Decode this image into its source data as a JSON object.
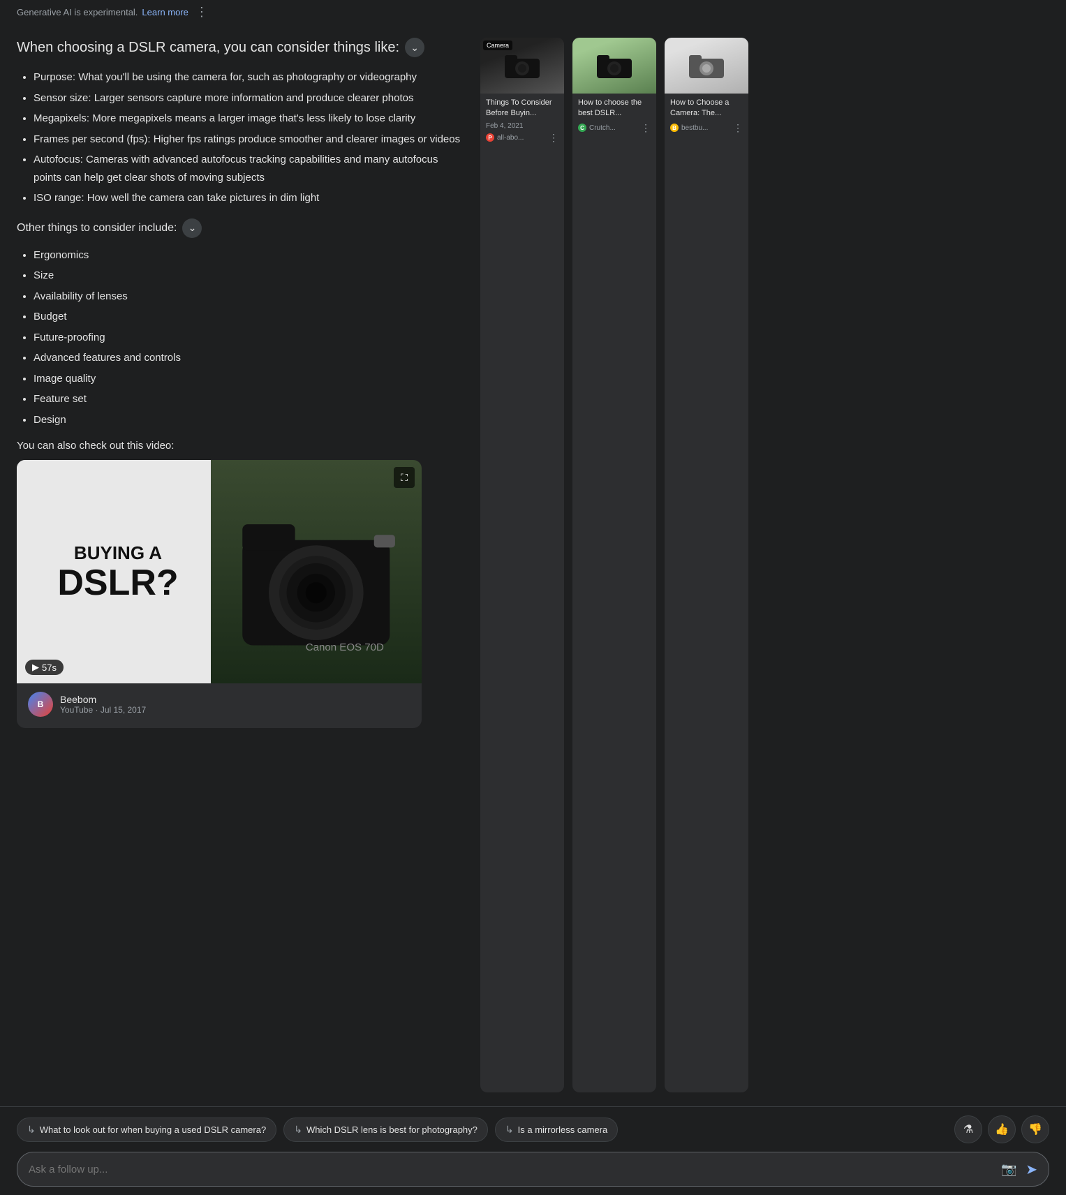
{
  "ai_notice": {
    "text": "Generative AI is experimental.",
    "learn_more": "Learn more"
  },
  "main_heading": {
    "text": "When choosing a DSLR camera, you can consider things like:",
    "dropdown_aria": "expand"
  },
  "primary_bullets": [
    "Purpose: What you'll be using the camera for, such as photography or videography",
    "Sensor size: Larger sensors capture more information and produce clearer photos",
    "Megapixels: More megapixels means a larger image that's less likely to lose clarity",
    "Frames per second (fps): Higher fps ratings produce smoother and clearer images or videos",
    "Autofocus: Cameras with advanced autofocus tracking capabilities and many autofocus points can help get clear shots of moving subjects",
    "ISO range: How well the camera can take pictures in dim light"
  ],
  "subheading": {
    "text": "Other things to consider include:",
    "dropdown_aria": "expand"
  },
  "secondary_bullets": [
    "Ergonomics",
    "Size",
    "Availability of lenses",
    "Budget",
    "Future-proofing",
    "Advanced features and controls",
    "Image quality",
    "Feature set",
    "Design"
  ],
  "video_intro": "You can also check out this video:",
  "video": {
    "title": "BUYING A DSLR?",
    "duration": "57s",
    "play_icon": "▶",
    "channel": "Beebom",
    "source": "YouTube · Jul 15, 2017",
    "expand_icon": "⛶"
  },
  "articles": [
    {
      "thumb_label": "Camera",
      "title": "Things To Consider Before Buyin...",
      "date": "Feb 4, 2021",
      "source": "all-abo...",
      "source_color": "#e94235",
      "source_letter": "P"
    },
    {
      "thumb_label": "",
      "title": "How to choose the best DSLR...",
      "date": "",
      "source": "Crutch...",
      "source_color": "#34a853",
      "source_letter": "C"
    },
    {
      "thumb_label": "",
      "title": "How to Choose a Camera: The...",
      "date": "",
      "source": "bestbu...",
      "source_color": "#fbbc04",
      "source_letter": "B"
    }
  ],
  "suggestions": [
    "What to look out for when buying a used DSLR camera?",
    "Which DSLR lens is best for photography?",
    "Is a mirrorless camera"
  ],
  "actions": {
    "labs_icon": "⚗",
    "like_icon": "👍",
    "dislike_icon": "👎"
  },
  "input": {
    "placeholder": "Ask a follow up...",
    "camera_icon": "📷",
    "send_icon": "➤"
  }
}
